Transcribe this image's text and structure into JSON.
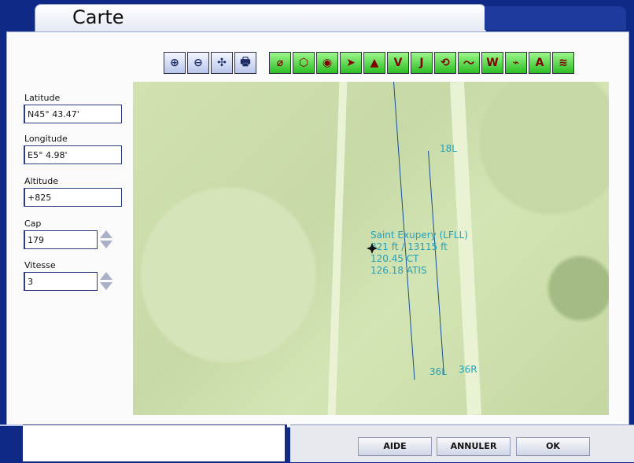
{
  "window": {
    "title": "Carte"
  },
  "toolbar": {
    "left_buttons": [
      "zoom-in",
      "zoom-out",
      "center",
      "print"
    ],
    "right_buttons": [
      {
        "icon": "approach-icon",
        "label": ""
      },
      {
        "icon": "traffic-icon",
        "label": ""
      },
      {
        "icon": "radio-icon",
        "label": ""
      },
      {
        "icon": "plane-icon",
        "label": ""
      },
      {
        "icon": "triangle-icon",
        "label": ""
      },
      {
        "icon": "vor-icon",
        "label": "V"
      },
      {
        "icon": "jet-icon",
        "label": "J"
      },
      {
        "icon": "loop-icon",
        "label": ""
      },
      {
        "icon": "route-icon",
        "label": ""
      },
      {
        "icon": "weather-icon",
        "label": "W"
      },
      {
        "icon": "airspace-icon",
        "label": ""
      },
      {
        "icon": "altitude-icon",
        "label": "A"
      },
      {
        "icon": "terrain-icon",
        "label": ""
      }
    ]
  },
  "fields": {
    "latitude_label": "Latitude",
    "latitude_value": "N45° 43.47'",
    "longitude_label": "Longitude",
    "longitude_value": "E5° 4.98'",
    "altitude_label": "Altitude",
    "altitude_value": "+825",
    "cap_label": "Cap",
    "cap_value": "179",
    "vitesse_label": "Vitesse",
    "vitesse_value": "3"
  },
  "map": {
    "airport_lines": [
      "Saint Exupery (LFLL)",
      "821 ft / 13115 ft",
      "120.45 CT",
      "126.18 ATIS"
    ],
    "runways": [
      "18L",
      "36L",
      "36R"
    ]
  },
  "buttons": {
    "aide": "AIDE",
    "annuler": "ANNULER",
    "ok": "OK"
  }
}
